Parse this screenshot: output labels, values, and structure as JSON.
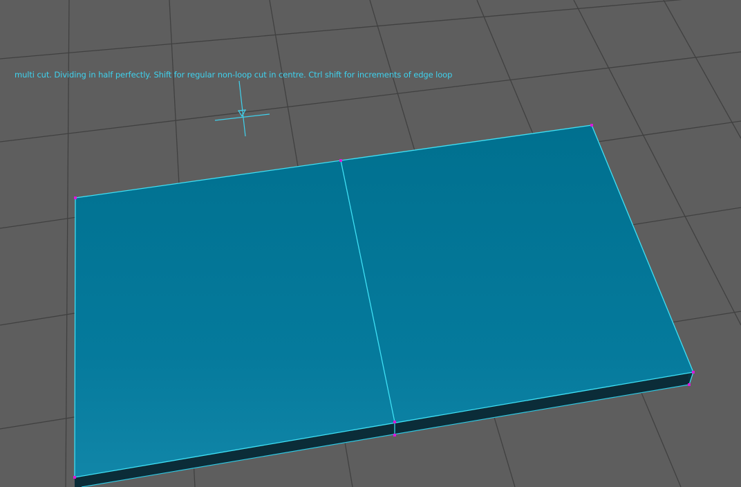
{
  "viewport": {
    "tool_hint": "multi cut. Dividing in half perfectly. Shift for regular non-loop cut in centre. Ctrl shift for increments of edge loop",
    "cursor_icon": "multi-cut-crosshair-icon"
  },
  "colors": {
    "background": "#5e5e5e",
    "grid_line": "#3f3f3f",
    "face_selected": "#0e7a9b",
    "face_selected_dark": "#00708f",
    "side_face": "#0b2c38",
    "wire_highlight": "#3fe0f5",
    "vertex": "#d81ad8",
    "hint_text": "#3fd2ee"
  }
}
